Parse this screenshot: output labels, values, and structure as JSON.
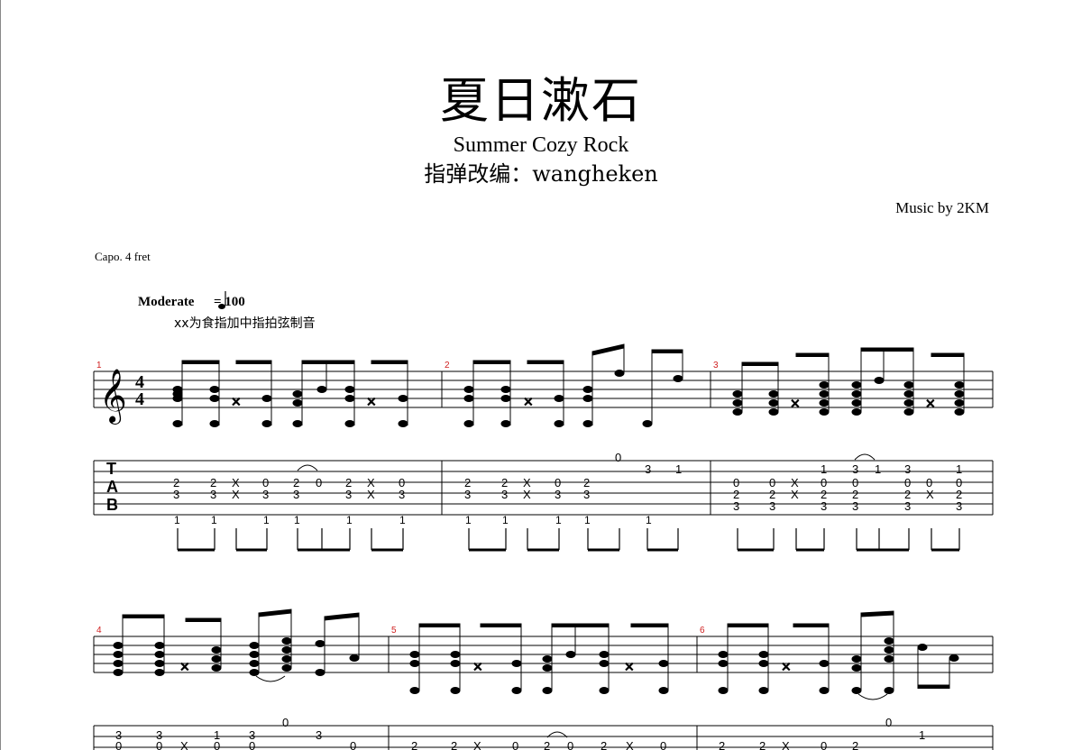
{
  "header": {
    "title": "夏日漱石",
    "subtitle": "Summer Cozy Rock",
    "arranger": "指弹改编：wangheken",
    "composer": "Music by 2KM"
  },
  "performance": {
    "capo": "Capo. 4 fret",
    "tempo_label": "Moderate",
    "tempo_value": "= 100",
    "technique_note": "xx为食指加中指拍弦制音"
  },
  "time_signature": {
    "top": "4",
    "bottom": "4"
  },
  "tab_clef": [
    "T",
    "A",
    "B"
  ],
  "measures": [
    {
      "number": "1",
      "tab": [
        [
          "2",
          "3"
        ],
        [
          "2",
          "3"
        ],
        [
          "X",
          "X"
        ],
        [
          "0",
          "3"
        ],
        [
          "2",
          "3"
        ],
        [
          "0"
        ],
        [
          "2",
          "3"
        ],
        [
          "X",
          "X"
        ],
        [
          "0",
          "3"
        ]
      ],
      "fingering": [
        "1",
        "1",
        "1",
        "1",
        "1",
        "1"
      ]
    },
    {
      "number": "2",
      "tab": [
        [
          "2",
          "3"
        ],
        [
          "2",
          "3"
        ],
        [
          "X",
          "X"
        ],
        [
          "0",
          "3"
        ],
        [
          "2",
          "3"
        ],
        [
          "0"
        ],
        [
          "3"
        ],
        [
          "1"
        ]
      ],
      "fingering": [
        "1",
        "1",
        "1",
        "1",
        "1"
      ]
    },
    {
      "number": "3",
      "tab": [
        [
          "0",
          "2",
          "3"
        ],
        [
          "0",
          "2",
          "3"
        ],
        [
          "X",
          "X"
        ],
        [
          "1",
          "0",
          "2",
          "3"
        ],
        [
          "3",
          "0",
          "2",
          "3"
        ],
        [
          "1"
        ],
        [
          "3",
          "0",
          "2",
          "3"
        ],
        [
          "0",
          "X"
        ],
        [
          "1",
          "0",
          "2",
          "3"
        ]
      ],
      "fingering": []
    },
    {
      "number": "4",
      "tab": [
        [
          "3",
          "0"
        ],
        [
          "3",
          "0"
        ],
        [
          "X"
        ],
        [
          "1",
          "0"
        ],
        [
          "3",
          "0"
        ],
        [
          "0"
        ],
        [
          "3"
        ],
        [
          "0"
        ]
      ],
      "fingering": []
    },
    {
      "number": "5",
      "tab": [
        [
          "2"
        ],
        [
          "2"
        ],
        [
          "X"
        ],
        [
          "0"
        ],
        [
          "2"
        ],
        [
          "0"
        ],
        [
          "2"
        ],
        [
          "X"
        ],
        [
          "0"
        ]
      ],
      "fingering": []
    },
    {
      "number": "6",
      "tab": [
        [
          "2"
        ],
        [
          "2"
        ],
        [
          "X"
        ],
        [
          "0"
        ],
        [
          "2"
        ],
        [
          "0"
        ],
        [
          "1"
        ]
      ],
      "fingering": []
    }
  ]
}
